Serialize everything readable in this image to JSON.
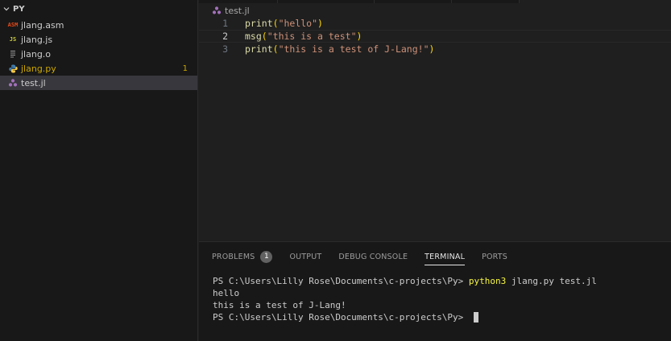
{
  "explorer": {
    "folder_name": "PY",
    "files": [
      {
        "name": "jlang.asm",
        "icon": "asm-file-icon",
        "icon_text": "ASM",
        "icon_color": "#e64a19",
        "badge": "",
        "warn": false,
        "active": false
      },
      {
        "name": "jlang.js",
        "icon": "js-file-icon",
        "icon_text": "JS",
        "icon_color": "#cbcb41",
        "badge": "",
        "warn": false,
        "active": false
      },
      {
        "name": "jlang.o",
        "icon": "generic-file-icon",
        "icon_text": "",
        "icon_color": "#9d9d9d",
        "badge": "",
        "warn": false,
        "active": false
      },
      {
        "name": "jlang.py",
        "icon": "python-file-icon",
        "icon_text": "",
        "icon_color": "#3f7cac",
        "badge": "1",
        "warn": true,
        "active": false
      },
      {
        "name": "test.jl",
        "icon": "julia-file-icon",
        "icon_text": "",
        "icon_color": "#a270ba",
        "badge": "",
        "warn": false,
        "active": true
      }
    ]
  },
  "editor": {
    "breadcrumb": "test.jl",
    "lines": [
      {
        "num": "1",
        "fn": "print",
        "arg": "\"hello\""
      },
      {
        "num": "2",
        "fn": "msg",
        "arg": "\"this is a test\""
      },
      {
        "num": "3",
        "fn": "print",
        "arg": "\"this is a test of J-Lang!\""
      }
    ],
    "current_line": 2
  },
  "panel": {
    "tabs": [
      "PROBLEMS",
      "OUTPUT",
      "DEBUG CONSOLE",
      "TERMINAL",
      "PORTS"
    ],
    "problems_count": "1",
    "active_tab": "TERMINAL"
  },
  "terminal": {
    "prompt": "PS C:\\Users\\Lilly Rose\\Documents\\c-projects\\Py> ",
    "command_exe": "python3",
    "command_args": " jlang.py test.jl",
    "output": [
      "hello",
      "this is a test of J-Lang!"
    ]
  },
  "colors": {
    "accent_warning": "#cca700",
    "string": "#ce9178",
    "function": "#dcdcaa",
    "bracket": "#ffd700"
  }
}
